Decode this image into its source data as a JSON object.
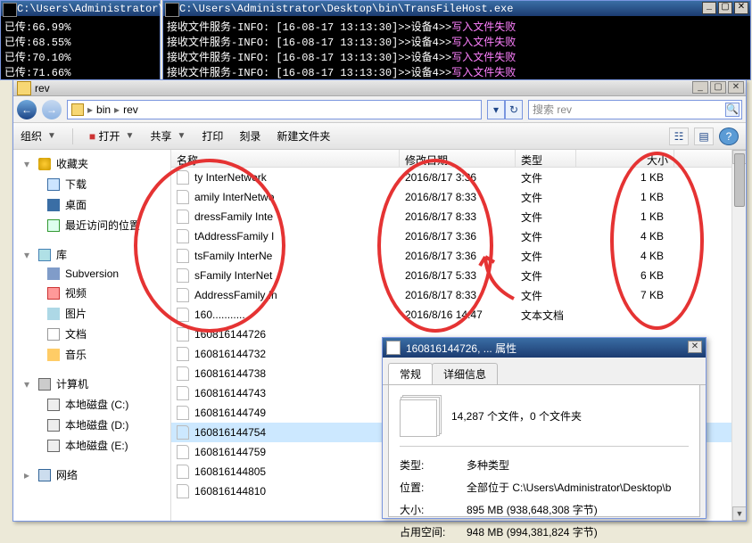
{
  "console_left": {
    "title": "C:\\Users\\Administrator\\",
    "lines": [
      "已传:66.99%",
      "已传:68.55%",
      "已传:70.10%",
      "已传:71.66%"
    ]
  },
  "console_right": {
    "title": "C:\\Users\\Administrator\\Desktop\\bin\\TransFileHost.exe",
    "prefix": "接收文件服务-INFO: [16-08-17 13:13:30]>>设备4>>",
    "suffix": "写入文件失败",
    "repeat": 4
  },
  "explorer": {
    "title": "rev",
    "nav_back": "←",
    "nav_fwd": "→",
    "breadcrumb": {
      "bin": "bin",
      "rev": "rev",
      "drop": "▾"
    },
    "refresh": "↻",
    "search_placeholder": "搜索 rev",
    "toolbar": {
      "organize": "组织",
      "open": "打开",
      "share": "共享",
      "print": "打印",
      "burn": "刻录",
      "newfolder": "新建文件夹"
    },
    "nav": {
      "favorites": "收藏夹",
      "downloads": "下载",
      "desktop": "桌面",
      "recent": "最近访问的位置",
      "library": "库",
      "subversion": "Subversion",
      "video": "视频",
      "pictures": "图片",
      "documents": "文档",
      "music": "音乐",
      "computer": "计算机",
      "drive_c": "本地磁盘 (C:)",
      "drive_d": "本地磁盘 (D:)",
      "drive_e": "本地磁盘 (E:)",
      "network": "网络"
    },
    "columns": {
      "name": "名称",
      "modified": "修改日期",
      "type": "类型",
      "size": "大小"
    },
    "files": [
      {
        "name": "ty InterNetwork",
        "date": "2016/8/17 3:36",
        "type": "文件",
        "size": "1 KB"
      },
      {
        "name": "amily InterNetwo",
        "date": "2016/8/17 8:33",
        "type": "文件",
        "size": "1 KB"
      },
      {
        "name": "dressFamily Inte",
        "date": "2016/8/17 8:33",
        "type": "文件",
        "size": "1 KB"
      },
      {
        "name": "tAddressFamily I",
        "date": "2016/8/17 3:36",
        "type": "文件",
        "size": "4 KB"
      },
      {
        "name": "tsFamily InterNe",
        "date": "2016/8/17 3:36",
        "type": "文件",
        "size": "4 KB"
      },
      {
        "name": "sFamily InterNet",
        "date": "2016/8/17 5:33",
        "type": "文件",
        "size": "6 KB"
      },
      {
        "name": "AddressFamily In",
        "date": "2016/8/17 8:33",
        "type": "文件",
        "size": "7 KB"
      },
      {
        "name": "160...........",
        "date": "2016/8/16 14:47",
        "type": "文本文档",
        "size": ""
      },
      {
        "name": "160816144726",
        "date": "",
        "type": "",
        "size": ""
      },
      {
        "name": "160816144732",
        "date": "",
        "type": "",
        "size": ""
      },
      {
        "name": "160816144738",
        "date": "",
        "type": "",
        "size": ""
      },
      {
        "name": "160816144743",
        "date": "",
        "type": "",
        "size": ""
      },
      {
        "name": "160816144749",
        "date": "",
        "type": "",
        "size": ""
      },
      {
        "name": "160816144754",
        "date": "",
        "type": "",
        "size": "",
        "sel": true
      },
      {
        "name": "160816144759",
        "date": "",
        "type": "",
        "size": ""
      },
      {
        "name": "160816144805",
        "date": "",
        "type": "",
        "size": ""
      },
      {
        "name": "160816144810",
        "date": "",
        "type": "",
        "size": ""
      }
    ]
  },
  "props": {
    "title": "160816144726, ... 属性",
    "tab_general": "常规",
    "tab_details": "详细信息",
    "summary": "14,287 个文件，0 个文件夹",
    "type_k": "类型:",
    "type_v": "多种类型",
    "loc_k": "位置:",
    "loc_v": "全部位于 C:\\Users\\Administrator\\Desktop\\b",
    "size_k": "大小:",
    "size_v": "895 MB (938,648,308 字节)",
    "disk_k": "占用空间:",
    "disk_v": "948 MB (994,381,824 字节)"
  }
}
